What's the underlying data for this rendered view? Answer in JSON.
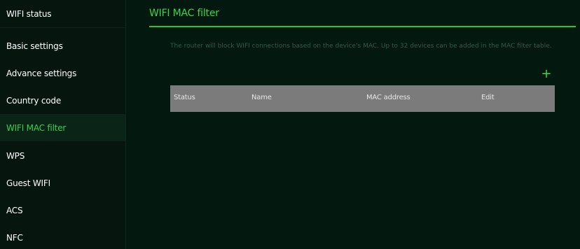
{
  "sidebar": {
    "items": [
      {
        "label": "WIFI status"
      },
      {
        "label": "Basic settings"
      },
      {
        "label": "Advance settings"
      },
      {
        "label": "Country code"
      },
      {
        "label": "WIFI MAC filter"
      },
      {
        "label": "WPS"
      },
      {
        "label": "Guest WIFI"
      },
      {
        "label": "ACS"
      },
      {
        "label": "NFC"
      }
    ],
    "active_index": 4
  },
  "main": {
    "title": "WIFI MAC filter",
    "description": "The router will block WIFI connections based on the device's MAC. Up to 32 devices can be added in the MAC filter table.",
    "add_button_label": "+",
    "table": {
      "columns": [
        "Status",
        "Name",
        "MAC address",
        "Edit"
      ],
      "rows": []
    }
  },
  "colors": {
    "accent": "#39d74b",
    "background": "#03180f",
    "sidebar_background": "#06160f",
    "table_header": "#7b7b7b"
  },
  "icons": {
    "add": "plus-icon"
  }
}
